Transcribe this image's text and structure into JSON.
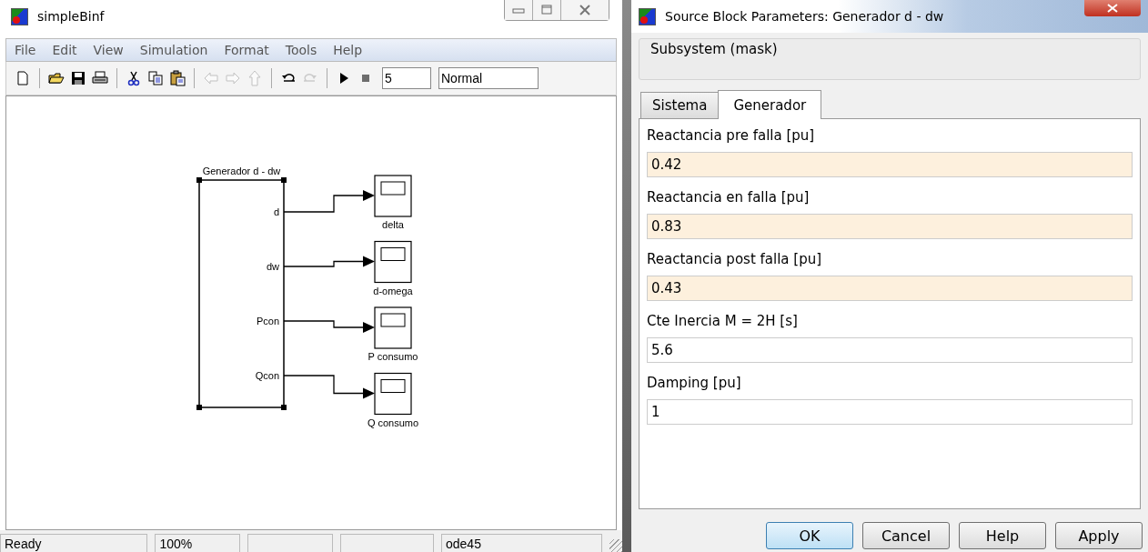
{
  "model_window": {
    "title": "simpleBinf",
    "menu": [
      "File",
      "Edit",
      "View",
      "Simulation",
      "Format",
      "Tools",
      "Help"
    ],
    "toolbar": [
      {
        "kind": "new",
        "disabled": false
      },
      {
        "kind": "sep"
      },
      {
        "kind": "open",
        "disabled": false
      },
      {
        "kind": "save",
        "disabled": false
      },
      {
        "kind": "print",
        "disabled": false
      },
      {
        "kind": "sep"
      },
      {
        "kind": "cut",
        "disabled": false
      },
      {
        "kind": "copy",
        "disabled": false
      },
      {
        "kind": "paste",
        "disabled": false
      },
      {
        "kind": "sep"
      },
      {
        "kind": "back",
        "disabled": true
      },
      {
        "kind": "forward",
        "disabled": true
      },
      {
        "kind": "up",
        "disabled": true
      },
      {
        "kind": "sep"
      },
      {
        "kind": "undo",
        "disabled": false
      },
      {
        "kind": "redo",
        "disabled": true
      },
      {
        "kind": "sep"
      },
      {
        "kind": "play",
        "disabled": false
      },
      {
        "kind": "stop",
        "disabled": true
      }
    ],
    "stop_time": "5",
    "sim_mode": "Normal",
    "diagram": {
      "block_title": "Generador d - dw",
      "ports": [
        "d",
        "dw",
        "Pcon",
        "Qcon"
      ],
      "scopes": [
        "delta",
        "d-omega",
        "P consumo",
        "Q consumo"
      ]
    },
    "status_bar": {
      "state": "Ready",
      "zoom": "100%",
      "solver": "ode45"
    }
  },
  "dialog": {
    "title": "Source Block Parameters: Generador d - dw",
    "group": "Subsystem (mask)",
    "tabs": [
      {
        "label": "Sistema",
        "selected": false
      },
      {
        "label": "Generador",
        "selected": true
      }
    ],
    "params": [
      {
        "label": "Reactancia pre falla [pu]",
        "value": "0.42",
        "highlighted": true
      },
      {
        "label": "Reactancia en falla [pu]",
        "value": "0.83",
        "highlighted": true
      },
      {
        "label": "Reactancia post falla [pu]",
        "value": "0.43",
        "highlighted": true
      },
      {
        "label": "Cte Inercia M = 2H [s]",
        "value": "5.6",
        "highlighted": false
      },
      {
        "label": "Damping [pu]",
        "value": "1",
        "highlighted": false
      }
    ],
    "buttons": [
      {
        "label": "OK",
        "default": true
      },
      {
        "label": "Cancel",
        "default": false
      },
      {
        "label": "Help",
        "default": false
      },
      {
        "label": "Apply",
        "default": false
      }
    ]
  }
}
